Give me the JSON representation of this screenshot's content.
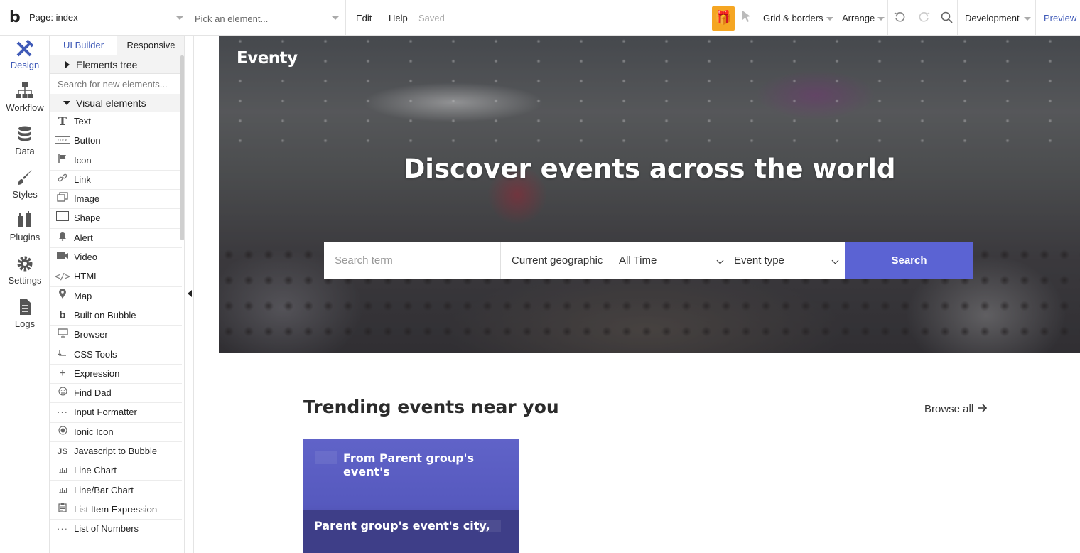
{
  "toolbar": {
    "logo": "b",
    "page_select": "Page: index",
    "element_picker": "Pick an element...",
    "edit": "Edit",
    "help": "Help",
    "status": "Saved",
    "grid_borders": "Grid & borders",
    "arrange": "Arrange",
    "environment": "Development",
    "preview": "Preview",
    "accent_color": "#3f5ab8",
    "gift_color": "#f5a623"
  },
  "rail": {
    "items": [
      {
        "label": "Design",
        "icon": "design-icon"
      },
      {
        "label": "Workflow",
        "icon": "workflow-icon"
      },
      {
        "label": "Data",
        "icon": "database-icon"
      },
      {
        "label": "Styles",
        "icon": "brush-icon"
      },
      {
        "label": "Plugins",
        "icon": "plug-icon"
      },
      {
        "label": "Settings",
        "icon": "gear-icon"
      },
      {
        "label": "Logs",
        "icon": "document-icon"
      }
    ]
  },
  "panel": {
    "tab_ui_builder": "UI Builder",
    "tab_responsive": "Responsive",
    "elements_tree": "Elements tree",
    "search_placeholder": "Search for new elements...",
    "visual_elements": "Visual elements",
    "items": [
      {
        "label": "Text",
        "icon": "text-icon"
      },
      {
        "label": "Button",
        "icon": "button-icon"
      },
      {
        "label": "Icon",
        "icon": "flag-icon"
      },
      {
        "label": "Link",
        "icon": "link-icon"
      },
      {
        "label": "Image",
        "icon": "image-icon"
      },
      {
        "label": "Shape",
        "icon": "shape-icon"
      },
      {
        "label": "Alert",
        "icon": "bell-icon"
      },
      {
        "label": "Video",
        "icon": "video-icon"
      },
      {
        "label": "HTML",
        "icon": "code-icon"
      },
      {
        "label": "Map",
        "icon": "map-pin-icon"
      },
      {
        "label": "Built on Bubble",
        "icon": "bubble-logo-icon"
      },
      {
        "label": "Browser",
        "icon": "monitor-icon"
      },
      {
        "label": "CSS Tools",
        "icon": "css-tools-icon"
      },
      {
        "label": "Expression",
        "icon": "plus-icon"
      },
      {
        "label": "Find Dad",
        "icon": "face-icon"
      },
      {
        "label": "Input Formatter",
        "icon": "dots-icon"
      },
      {
        "label": "Ionic Icon",
        "icon": "ionic-icon"
      },
      {
        "label": "Javascript to Bubble",
        "icon": "js-icon"
      },
      {
        "label": "Line Chart",
        "icon": "line-chart-icon"
      },
      {
        "label": "Line/Bar Chart",
        "icon": "bar-chart-icon"
      },
      {
        "label": "List Item Expression",
        "icon": "clipboard-icon"
      },
      {
        "label": "List of Numbers",
        "icon": "dots-icon"
      }
    ]
  },
  "canvas": {
    "brand": "Eventy",
    "headline": "Discover events across the world",
    "search_term_placeholder": "Search term",
    "location_value": "Current geographic",
    "time_value": "All Time",
    "event_type_value": "Event type",
    "search_button": "Search",
    "button_color": "#5b63d3",
    "trending_title": "Trending events near you",
    "browse_all": "Browse all",
    "card_title": "From Parent group's event's",
    "card_city": "Parent group's event's city,"
  }
}
